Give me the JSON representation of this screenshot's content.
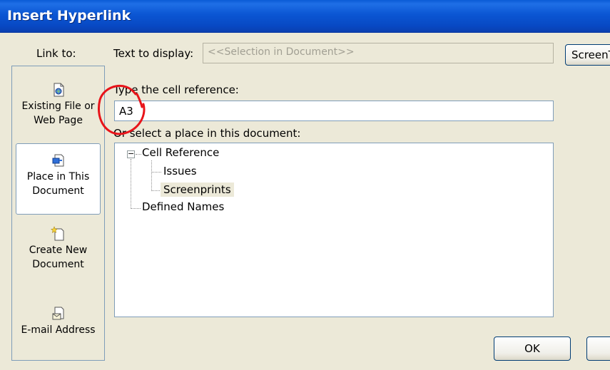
{
  "window": {
    "title": "Insert Hyperlink"
  },
  "labels": {
    "link_to": "Link to:",
    "text_to_display": "Text to display:",
    "type_cell_reference": "Type the cell reference:",
    "select_place": "Or select a place in this document:"
  },
  "fields": {
    "text_to_display_value": "<<Selection in Document>>",
    "cell_reference_value": "A3"
  },
  "buttons": {
    "screentip": "ScreenTip...",
    "ok": "OK"
  },
  "sidebar": {
    "items": [
      {
        "line1": "Existing File or",
        "line2": "Web Page",
        "icon": "existing-file-icon"
      },
      {
        "line1": "Place in This",
        "line2": "Document",
        "icon": "place-in-document-icon",
        "selected": true
      },
      {
        "line1": "Create New",
        "line2": "Document",
        "icon": "new-document-icon"
      },
      {
        "line1": "E-mail Address",
        "icon": "email-icon"
      }
    ]
  },
  "tree": {
    "root": "Cell Reference",
    "children": [
      "Issues",
      "Screenprints"
    ],
    "selected": "Screenprints",
    "second_root": "Defined Names"
  },
  "colors": {
    "titlebar": "#0a4fcf",
    "dialog_bg": "#ece9d8",
    "annotation": "#e8141a"
  }
}
